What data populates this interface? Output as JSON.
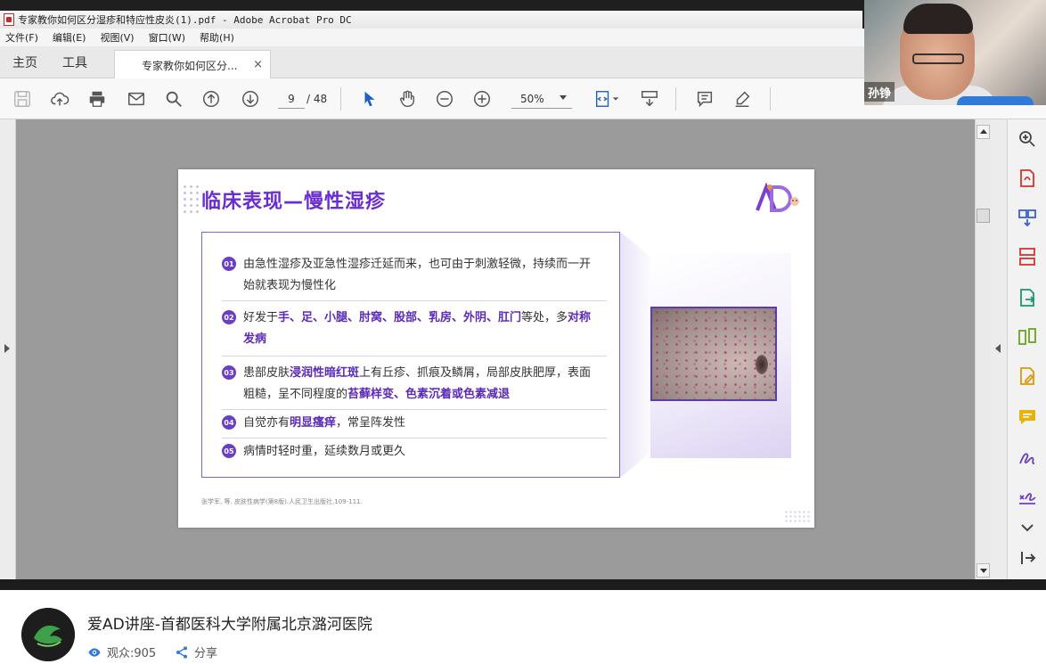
{
  "window": {
    "title": "专家教你如何区分湿疹和特应性皮炎(1).pdf - Adobe Acrobat Pro DC"
  },
  "menu": [
    "文件(F)",
    "编辑(E)",
    "视图(V)",
    "窗口(W)",
    "帮助(H)"
  ],
  "tabs": {
    "home": "主页",
    "tools": "工具",
    "document": "专家教你如何区分...",
    "close": "×"
  },
  "toolbar": {
    "page_current": "9",
    "page_total": "/ 48",
    "zoom": "50%"
  },
  "video": {
    "speaker_name": "孙铮"
  },
  "slide": {
    "title": "临床表现—慢性湿疹",
    "points": [
      {
        "num": "01",
        "segments": [
          {
            "t": "由急性湿疹及亚急性湿疹迁延而来，也可由于刺激轻微，持续而一开始就表现为慢性化",
            "b": false
          }
        ]
      },
      {
        "num": "02",
        "segments": [
          {
            "t": "好发于",
            "b": false
          },
          {
            "t": "手、足、小腿、肘窝、股部、乳房、外阴、肛门",
            "b": true
          },
          {
            "t": "等处，多",
            "b": false
          },
          {
            "t": "对称发病",
            "b": true
          }
        ]
      },
      {
        "num": "03",
        "segments": [
          {
            "t": "患部皮肤",
            "b": false
          },
          {
            "t": "浸润性暗红斑",
            "b": true
          },
          {
            "t": "上有丘疹、抓痕及鳞屑，局部皮肤肥厚，表面粗糙，呈不同程度的",
            "b": false
          },
          {
            "t": "苔藓样变、色素沉着或色素减退",
            "b": true
          }
        ]
      },
      {
        "num": "04",
        "segments": [
          {
            "t": "自觉亦有",
            "b": false
          },
          {
            "t": "明显瘙痒",
            "b": true
          },
          {
            "t": "，常呈阵发性",
            "b": false
          }
        ]
      },
      {
        "num": "05",
        "segments": [
          {
            "t": "病情时轻时重，延续数月或更久",
            "b": false
          }
        ]
      }
    ],
    "reference": "张学军, 等. 皮肤性病学(第8版).人民卫生出版社,109-111."
  },
  "live": {
    "title": "爱AD讲座-首都医科大学附属北京潞河医院",
    "viewers": "观众:905",
    "share": "分享"
  },
  "colors": {
    "accent_purple": "#6a2ed0",
    "box_border": "#7e64c8",
    "toolbar_icon": "#555555"
  }
}
